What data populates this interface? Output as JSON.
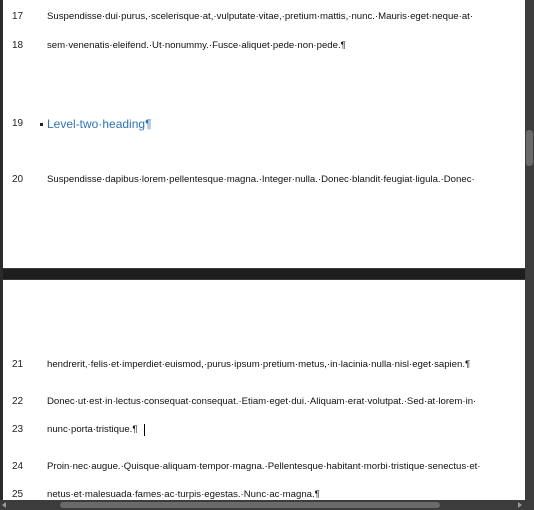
{
  "document": {
    "page1": {
      "lines": [
        {
          "num": "17",
          "text": "Suspendisse·dui·purus,·scelerisque·at,·vulputate·vitae,·pretium·mattis,·nunc.·Mauris·eget·neque·at·"
        },
        {
          "num": "18",
          "text": "sem·venenatis·eleifend.·Ut·nonummy.·Fusce·aliquet·pede·non·pede.¶"
        },
        {
          "num": "19",
          "text": "Level-two·heading¶"
        },
        {
          "num": "20",
          "text": "Suspendisse·dapibus·lorem·pellentesque·magna.·Integer·nulla.·Donec·blandit·feugiat·ligula.·Donec·"
        }
      ]
    },
    "page2": {
      "lines": [
        {
          "num": "21",
          "text": "hendrerit,·felis·et·imperdiet·euismod,·purus·ipsum·pretium·metus,·in·lacinia·nulla·nisl·eget·sapien.¶"
        },
        {
          "num": "22",
          "text": "Donec·ut·est·in·lectus·consequat·consequat.·Etiam·eget·dui.·Aliquam·erat·volutpat.·Sed·at·lorem·in·"
        },
        {
          "num": "23",
          "text": "nunc·porta·tristique.¶"
        },
        {
          "num": "24",
          "text": "Proin·nec·augue.·Quisque·aliquam·tempor·magna.·Pellentesque·habitant·morbi·tristique·senectus·et·"
        },
        {
          "num": "25",
          "text": "netus·et·malesuada·fames·ac·turpis·egestas.·Nunc·ac·magna.¶"
        }
      ]
    }
  },
  "colors": {
    "heading": "#2e74b5",
    "background": "#2b2b2b",
    "page": "#ffffff"
  }
}
